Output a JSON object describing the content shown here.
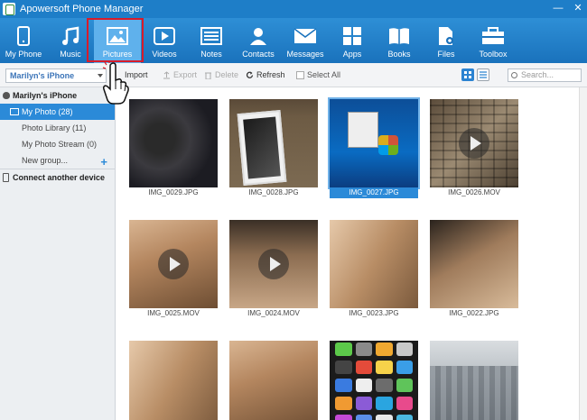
{
  "window": {
    "title": "Apowersoft Phone Manager",
    "min": "—",
    "close": "✕"
  },
  "toolbar": [
    {
      "label": "My Phone",
      "icon": "phone-icon"
    },
    {
      "label": "Music",
      "icon": "music-note-icon"
    },
    {
      "label": "Pictures",
      "icon": "picture-icon",
      "active": true
    },
    {
      "label": "Videos",
      "icon": "video-play-icon"
    },
    {
      "label": "Notes",
      "icon": "notes-icon"
    },
    {
      "label": "Contacts",
      "icon": "contact-person-icon"
    },
    {
      "label": "Messages",
      "icon": "envelope-icon"
    },
    {
      "label": "Apps",
      "icon": "apps-grid-icon"
    },
    {
      "label": "Books",
      "icon": "book-icon"
    },
    {
      "label": "Files",
      "icon": "file-gear-icon"
    },
    {
      "label": "Toolbox",
      "icon": "toolbox-icon"
    }
  ],
  "actions": {
    "device": "Marilyn's iPhone",
    "import": "Import",
    "export": "Export",
    "delete": "Delete",
    "refresh": "Refresh",
    "select_all": "Select All",
    "search_placeholder": "Search..."
  },
  "sidebar": {
    "device_name": "Marilyn's iPhone",
    "items": [
      {
        "label": "My Photo (28)",
        "selected": true
      },
      {
        "label": "Photo Library (11)"
      },
      {
        "label": "My Photo Stream (0)"
      },
      {
        "label": "New group..."
      }
    ],
    "connect": "Connect another device"
  },
  "photos": [
    {
      "name": "IMG_0029.JPG"
    },
    {
      "name": "IMG_0028.JPG"
    },
    {
      "name": "IMG_0027.JPG",
      "selected": true
    },
    {
      "name": "IMG_0026.MOV",
      "video": true
    },
    {
      "name": "IMG_0025.MOV",
      "video": true
    },
    {
      "name": "IMG_0024.MOV",
      "video": true
    },
    {
      "name": "IMG_0023.JPG"
    },
    {
      "name": "IMG_0022.JPG"
    }
  ],
  "colors": {
    "accent": "#2b8ad8",
    "toolbar": "#1e7ec8",
    "highlight": "#d81b2a"
  }
}
